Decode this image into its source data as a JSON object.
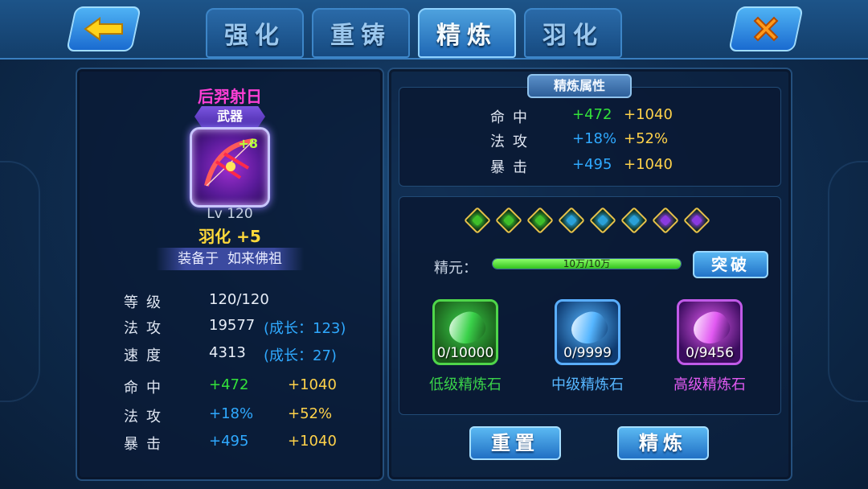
{
  "tabs": [
    "强化",
    "重铸",
    "精炼",
    "羽化"
  ],
  "active_tab": 2,
  "item": {
    "name": "后羿射日",
    "type": "武器",
    "plus": "+8",
    "level": "Lv 120",
    "feather": "羽化 +5",
    "equipped_prefix": "装备于",
    "equipped_on": "如来佛祖"
  },
  "base_stats": [
    {
      "label": "等级",
      "value": "120/120",
      "growth": ""
    },
    {
      "label": "法攻",
      "value": "19577",
      "growth": "(成长：123)"
    },
    {
      "label": "速度",
      "value": "4313",
      "growth": "(成长：27)"
    }
  ],
  "bonus_stats": [
    {
      "label": "命中",
      "v1": "+472",
      "v2": "+1040",
      "v1_color": "green"
    },
    {
      "label": "法攻",
      "v1": "+18%",
      "v2": "+52%",
      "v1_color": "blue"
    },
    {
      "label": "暴击",
      "v1": "+495",
      "v2": "+1040",
      "v1_color": "blue"
    }
  ],
  "refine_attr": {
    "title": "精炼属性",
    "rows": [
      {
        "label": "命中",
        "v1": "+472",
        "v2": "+1040",
        "v1_color": "green"
      },
      {
        "label": "法攻",
        "v1": "+18%",
        "v2": "+52%",
        "v1_color": "blue"
      },
      {
        "label": "暴击",
        "v1": "+495",
        "v2": "+1040",
        "v1_color": "blue"
      }
    ]
  },
  "gems": [
    "green",
    "green",
    "green",
    "blue",
    "blue",
    "blue",
    "purple",
    "purple"
  ],
  "essence": {
    "label": "精元：",
    "text": "10万/10万",
    "fraction": 1.0
  },
  "break_button": "突破",
  "stones": [
    {
      "count": "0/10000",
      "name": "低级精炼石",
      "color": "#3ad24a",
      "frame": "#4fd64a",
      "bg": "#1a5a1a"
    },
    {
      "count": "0/9999",
      "name": "中级精炼石",
      "color": "#56b6ff",
      "frame": "#5aaeff",
      "bg": "#0e3a70"
    },
    {
      "count": "0/9456",
      "name": "高级精炼石",
      "color": "#e25af2",
      "frame": "#c15ae8",
      "bg": "#3a0c5e"
    }
  ],
  "buttons": {
    "reset": "重置",
    "refine": "精炼"
  },
  "colors": {
    "green": "#33e23a",
    "blue": "#2fa9ff",
    "gold": "#ffd24a",
    "gem_green": "#3fbf2a",
    "gem_blue": "#2aa0d8",
    "gem_purple": "#8a3ae0"
  }
}
